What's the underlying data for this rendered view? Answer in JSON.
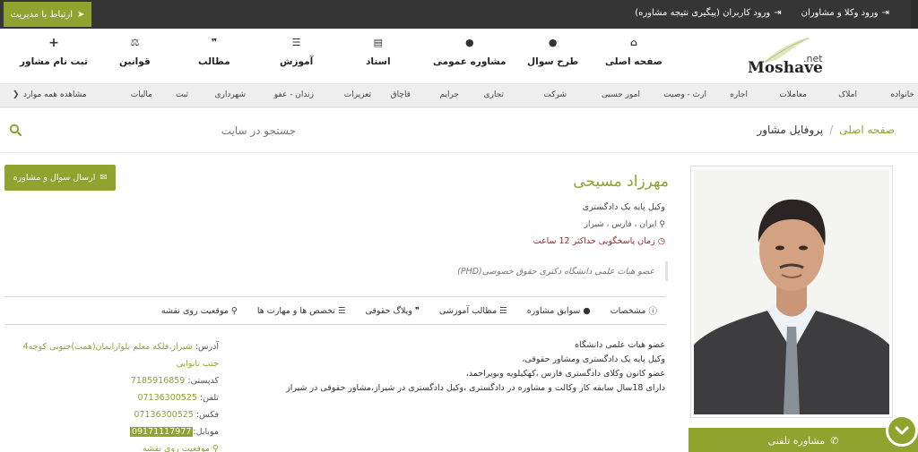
{
  "topbar": {
    "contact_admin": "ارتباط با مدیریت",
    "user_login": "ورود کاربران (پیگیری نتیجه مشاوره)",
    "lawyer_login": "ورود وکلا و مشاوران"
  },
  "logo": {
    "main": "Moshavere",
    "suffix": ".net"
  },
  "nav": [
    {
      "label": "صفحه اصلی",
      "icon": "home-icon"
    },
    {
      "label": "طرح سوال",
      "icon": "comment-icon"
    },
    {
      "label": "مشاوره عمومی",
      "icon": "comments-icon"
    },
    {
      "label": "اسناد",
      "icon": "document-icon"
    },
    {
      "label": "آموزش",
      "icon": "list-icon"
    },
    {
      "label": "مطالب",
      "icon": "quote-icon"
    },
    {
      "label": "قوانین",
      "icon": "balance-icon"
    },
    {
      "label": "ثبت نام مشاور",
      "icon": "plus-icon"
    }
  ],
  "categories": [
    "خانواده",
    "املاک",
    "معاملات",
    "اجاره",
    "ارث - وصیت",
    "امور حسبی",
    "شرکت",
    "تجاری",
    "جرایم",
    "قاچاق",
    "تعزیرات",
    "زندان - عفو",
    "شهرداری",
    "ثبت",
    "مالیات",
    "مشاهده همه موارد"
  ],
  "search": {
    "placeholder": "جستجو در سایت"
  },
  "breadcrumb": {
    "home": "صفحه اصلی",
    "sep": "/",
    "current": "پروفایل مشاور"
  },
  "send_question": "ارسال سوال و مشاوره",
  "profile": {
    "name": "مهرزاد مسیحی",
    "title": "وکیل پایه یک دادگستری",
    "location": "ایران ، فارس ، شیراز",
    "response_time": "زمان پاسخگویی حداکثر 12 ساعت",
    "quote": "عضو هیات علمی دانشگاه دکتری حقوق خصوصی(PHD)"
  },
  "tabs": [
    "مشخصات",
    "سوابق مشاوره",
    "مطالب آموزشی",
    "ویلاگ حقوقی",
    "تخصص ها و مهارت ها",
    "موقعیت روی نقشه"
  ],
  "bio": [
    "عضو هیات علمی دانشگاه",
    "وکیل پایه یک دادگستری ومشاور حقوقی،",
    "عضو کانون وکلای دادگستری فارس ،کهکیلویه وبویراحمد،",
    "دارای 18سال سابقه کار وکالت و مشاوره در دادگستری ،وکیل دادگستری در شیراز،مشاور حقوقی در شیراز"
  ],
  "contact": {
    "address_label": "آدرس:",
    "address": "شیراز،فلکه معلم بلوارایمان(همت)جنوبی کوچه4 جنب نانوایی",
    "postal_label": "کدپستی:",
    "postal": "7185916859",
    "phone_label": "تلفن:",
    "phone": "07136300525",
    "fax_label": "فکس:",
    "fax": "07136300525",
    "mobile_label": "موبایل:",
    "mobile": "09171117977",
    "map_link": "موقعیت روی نقشه"
  },
  "phone_consult": "مشاوره تلفنی",
  "colors": {
    "accent": "#8fa32e",
    "topbar": "#353535",
    "alert": "#a1262b"
  }
}
